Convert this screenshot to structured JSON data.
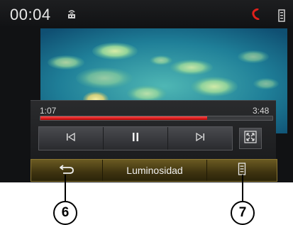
{
  "status_bar": {
    "time": "00:04",
    "icons": [
      "signal-icon",
      "phone-icon",
      "menu-icon"
    ],
    "phone_color": "#e0201b"
  },
  "player": {
    "elapsed": "1:07",
    "total": "3:48",
    "progress": 0.72,
    "progress_color": "#d40000",
    "controls": [
      "previous-track-icon",
      "pause-icon",
      "next-track-icon"
    ],
    "fullscreen_icon": "fullscreen-icon"
  },
  "bottom_bar": {
    "back_icon": "back-arrow-icon",
    "brightness_label": "Luminosidad",
    "options_icon": "options-list-icon",
    "accent": "#7a6424"
  },
  "callouts": {
    "back": "6",
    "options": "7"
  }
}
